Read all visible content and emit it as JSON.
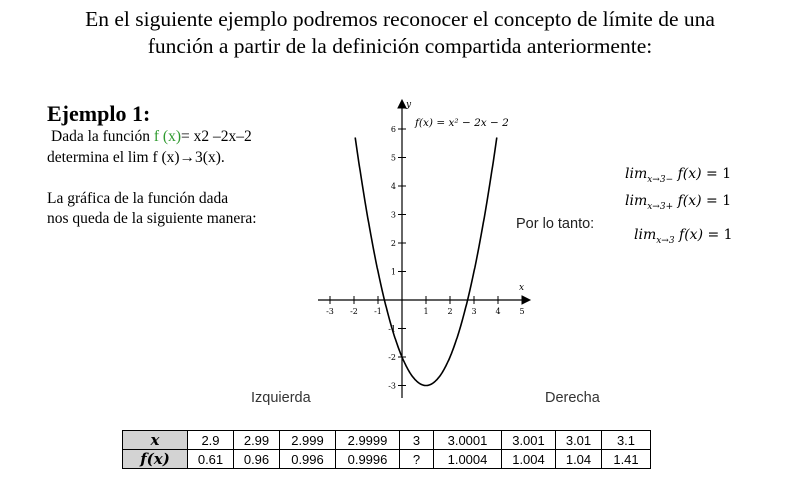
{
  "title": {
    "line1": "En el siguiente ejemplo podremos reconocer el concepto de límite de una",
    "line2": "función a partir de la definición compartida anteriormente:"
  },
  "example": {
    "heading": "Ejemplo 1:",
    "line1_prefix": "Dada la función ",
    "line1_func": "f (x)",
    "line1_suffix": "= x2 –2x–2",
    "line2": "determina el lim f (x)→3(x).",
    "line3": "La gráfica de la función dada",
    "line4": "nos queda de la siguiente manera:"
  },
  "graph": {
    "function_label": "f(x) = x² − 2x − 2",
    "x_axis_label": "x",
    "y_axis_label": "y",
    "x_ticks": [
      "-3",
      "-2",
      "-1",
      "1",
      "2",
      "3",
      "4",
      "5"
    ],
    "y_ticks": [
      "6",
      "5",
      "4",
      "3",
      "2",
      "1",
      "-1",
      "-2",
      "-3"
    ],
    "left_label": "Izquierda",
    "right_label": "Derecha",
    "curve_color": "#000000"
  },
  "conclusion": {
    "label": "Por lo tanto:",
    "lim_left_sub": "x→3−",
    "lim_right_sub": "x→3+",
    "lim_both_sub": "x→3",
    "lim_word": "lim",
    "fx": "f(x)",
    "eq": " = 1"
  },
  "table": {
    "row_x_label": "x",
    "row_f_label": "f(x)",
    "x_values": [
      "2.9",
      "2.99",
      "2.999",
      "2.9999",
      "3",
      "3.0001",
      "3.001",
      "3.01",
      "3.1"
    ],
    "f_values": [
      "0.61",
      "0.96",
      "0.996",
      "0.9996",
      "?",
      "1.0004",
      "1.004",
      "1.04",
      "1.41"
    ]
  }
}
